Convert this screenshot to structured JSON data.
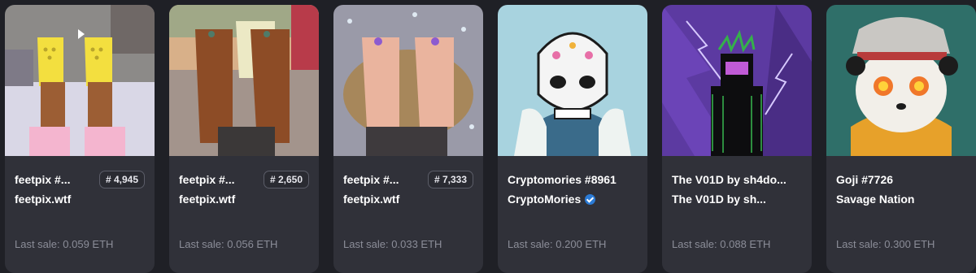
{
  "cards": [
    {
      "name": "feetpix #...",
      "rank": "# 4,945",
      "collection": "feetpix.wtf",
      "verified": false,
      "sale_label": "Last sale:",
      "sale_price": "0.059 ETH"
    },
    {
      "name": "feetpix #...",
      "rank": "# 2,650",
      "collection": "feetpix.wtf",
      "verified": false,
      "sale_label": "Last sale:",
      "sale_price": "0.056 ETH"
    },
    {
      "name": "feetpix #...",
      "rank": "# 7,333",
      "collection": "feetpix.wtf",
      "verified": false,
      "sale_label": "Last sale:",
      "sale_price": "0.033 ETH"
    },
    {
      "name": "Cryptomories #8961",
      "rank": "",
      "collection": "CryptoMories",
      "verified": true,
      "sale_label": "Last sale:",
      "sale_price": "0.200 ETH"
    },
    {
      "name": "The V01D by sh4do...",
      "rank": "",
      "collection": "The V01D by sh...",
      "verified": false,
      "sale_label": "Last sale:",
      "sale_price": "0.088 ETH"
    },
    {
      "name": "Goji #7726",
      "rank": "",
      "collection": "Savage Nation",
      "verified": false,
      "sale_label": "Last sale:",
      "sale_price": "0.300 ETH"
    }
  ],
  "colors": {
    "card_bg": "#303139",
    "page_bg": "#1f2026",
    "muted": "#8b8d98",
    "verified": "#2b7bd6"
  }
}
